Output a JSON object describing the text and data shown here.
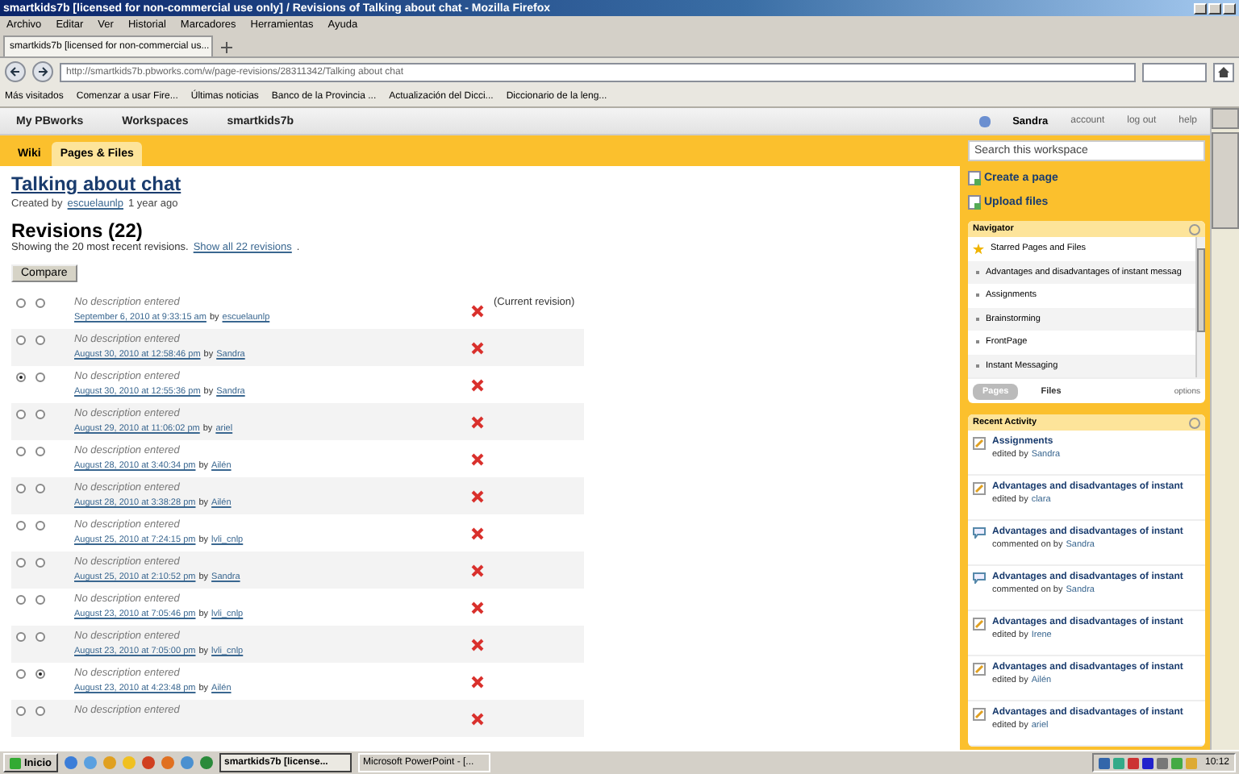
{
  "window": {
    "title": "smartkids7b [licensed for non-commercial use only] / Revisions of Talking about chat - Mozilla Firefox"
  },
  "menu": [
    "Archivo",
    "Editar",
    "Ver",
    "Historial",
    "Marcadores",
    "Herramientas",
    "Ayuda"
  ],
  "browser_tabs": [
    {
      "label": "smartkids7b [licensed for non-commercial us...",
      "selected": true
    }
  ],
  "address": {
    "value": "http://smartkids7b.pbworks.com/w/page-revisions/28311342/Talking about chat"
  },
  "bookmarks": [
    "Más visitados",
    "Comenzar a usar Fire...",
    "Últimas noticias",
    "Banco de la Provincia ...",
    "Actualización del Dicci...",
    "Diccionario de la leng..."
  ],
  "site_nav": {
    "items": [
      "My PBworks",
      "Workspaces",
      "smartkids7b"
    ],
    "user": "Sandra",
    "links": [
      "account",
      "log out",
      "help"
    ]
  },
  "page_tabs": [
    {
      "label": "Wiki",
      "selected": false
    },
    {
      "label": "Pages & Files",
      "selected": true
    }
  ],
  "search": {
    "placeholder": "Search this workspace"
  },
  "page": {
    "title": "Talking about chat",
    "created_prefix": "Created by",
    "creator": "escuelaunlp",
    "created_when": "1 year ago",
    "heading": "Revisions (22)",
    "showing": "Showing the 20 most recent revisions.",
    "show_all": "Show all 22 revisions",
    "show_all_end": ".",
    "compare": "Compare"
  },
  "revisions": [
    {
      "description": "No description entered",
      "date": "September 6, 2010 at 9:33:15 am",
      "author": "escuelaunlp",
      "by": "by",
      "note": "(Current revision)",
      "from": false,
      "to": false
    },
    {
      "description": "No description entered",
      "date": "August 30, 2010 at 12:58:46 pm",
      "author": "Sandra",
      "by": "by",
      "from": false,
      "to": false
    },
    {
      "description": "No description entered",
      "date": "August 30, 2010 at 12:55:36 pm",
      "author": "Sandra",
      "by": "by",
      "from": true,
      "to": false
    },
    {
      "description": "No description entered",
      "date": "August 29, 2010 at 11:06:02 pm",
      "author": "ariel",
      "by": "by",
      "from": false,
      "to": false
    },
    {
      "description": "No description entered",
      "date": "August 28, 2010 at 3:40:34 pm",
      "author": "Ailén",
      "by": "by",
      "from": false,
      "to": false
    },
    {
      "description": "No description entered",
      "date": "August 28, 2010 at 3:38:28 pm",
      "author": "Ailén",
      "by": "by",
      "from": false,
      "to": false
    },
    {
      "description": "No description entered",
      "date": "August 25, 2010 at 7:24:15 pm",
      "author": "lvli_cnlp",
      "by": "by",
      "from": false,
      "to": false
    },
    {
      "description": "No description entered",
      "date": "August 25, 2010 at 2:10:52 pm",
      "author": "Sandra",
      "by": "by",
      "from": false,
      "to": false
    },
    {
      "description": "No description entered",
      "date": "August 23, 2010 at 7:05:46 pm",
      "author": "lvli_cnlp",
      "by": "by",
      "from": false,
      "to": false
    },
    {
      "description": "No description entered",
      "date": "August 23, 2010 at 7:05:00 pm",
      "author": "lvli_cnlp",
      "by": "by",
      "from": false,
      "to": false
    },
    {
      "description": "No description entered",
      "date": "August 23, 2010 at 4:23:48 pm",
      "author": "Ailén",
      "by": "by",
      "from": false,
      "to": true
    },
    {
      "description": "No description entered",
      "from": false,
      "to": false
    }
  ],
  "sidebar_actions": [
    "Create a page",
    "Upload files"
  ],
  "navigator": {
    "title": "Navigator",
    "starred": "Starred Pages and Files",
    "items": [
      "Advantages and disadvantages of instant messag",
      "Assignments",
      "Brainstorming",
      "FrontPage",
      "Instant Messaging"
    ],
    "tabs": [
      {
        "label": "Pages",
        "selected": true
      },
      {
        "label": "Files",
        "selected": false
      }
    ],
    "options": "options"
  },
  "recent_activity": {
    "title": "Recent Activity",
    "items": [
      {
        "kind": "edit",
        "page": "Assignments",
        "action": "edited by",
        "user": "Sandra"
      },
      {
        "kind": "edit",
        "page": "Advantages and disadvantages of instant",
        "action": "edited by",
        "user": "clara"
      },
      {
        "kind": "comment",
        "page": "Advantages and disadvantages of instant",
        "action": "commented on by",
        "user": "Sandra"
      },
      {
        "kind": "comment",
        "page": "Advantages and disadvantages of instant",
        "action": "commented on by",
        "user": "Sandra"
      },
      {
        "kind": "edit",
        "page": "Advantages and disadvantages of instant",
        "action": "edited by",
        "user": "Irene"
      },
      {
        "kind": "edit",
        "page": "Advantages and disadvantages of instant",
        "action": "edited by",
        "user": "Ailén"
      },
      {
        "kind": "edit",
        "page": "Advantages and disadvantages of instant",
        "action": "edited by",
        "user": "ariel"
      }
    ]
  },
  "taskbar": {
    "start": "Inicio",
    "windows": [
      {
        "label": "smartkids7b [license...",
        "selected": true
      },
      {
        "label": "Microsoft PowerPoint - [...",
        "selected": false
      }
    ],
    "clock": "10:12"
  }
}
